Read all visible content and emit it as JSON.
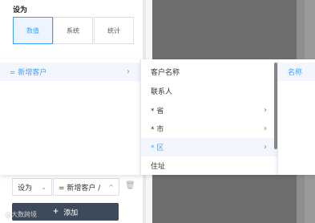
{
  "panel": {
    "set_label": "设为",
    "segments": [
      "数值",
      "系统",
      "统计"
    ]
  },
  "cascader": {
    "col1": [
      {
        "label": "= 新增客户",
        "arrow": "›"
      }
    ],
    "col2": [
      {
        "label": "客户名称",
        "arrow": ""
      },
      {
        "label": "联系人",
        "arrow": ""
      },
      {
        "label": "* 省",
        "arrow": "›"
      },
      {
        "label": "* 市",
        "arrow": "›"
      },
      {
        "label": "* 区",
        "arrow": "›"
      },
      {
        "label": "住址",
        "arrow": ""
      }
    ],
    "col3": [
      {
        "label": "名称"
      }
    ]
  },
  "bottom": {
    "select_a": "设为",
    "select_b": "= 新增客户 /",
    "caret_a": "⌄",
    "caret_b": "^",
    "add_label": "添加",
    "add_icon": "+",
    "trash_icon": "🗑"
  },
  "watermark": "@大数跨境",
  "colors": {
    "accent": "#409eff",
    "button_bg": "#3d4a5c",
    "overlay": "#6e6e6e"
  }
}
